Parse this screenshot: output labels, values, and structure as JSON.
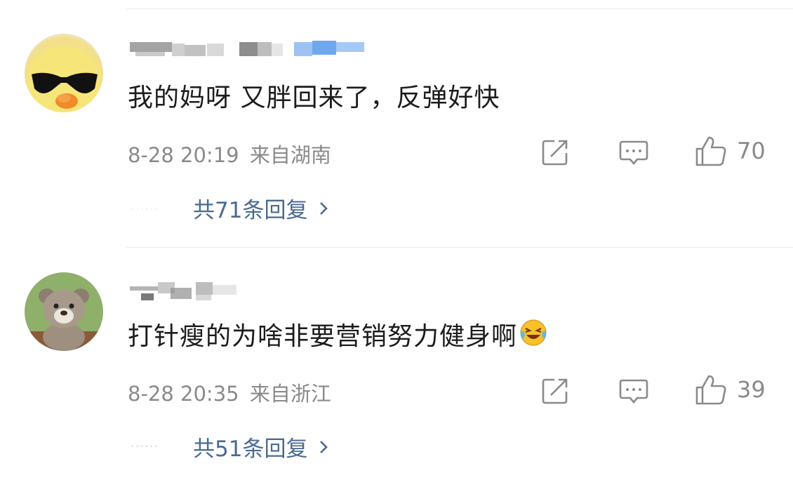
{
  "comments": [
    {
      "username": "",
      "text": "我的妈呀 又胖回来了，反弹好快",
      "time": "8-28 20:19",
      "location": "来自湖南",
      "likes": "70",
      "replies_label": "共71条回复",
      "avatar_icon": "yellow-duck-sunglasses",
      "text_emoji": ""
    },
    {
      "username": "",
      "text": "打针瘦的为啥非要营销努力健身啊",
      "time": "8-28 20:35",
      "location": "来自浙江",
      "likes": "39",
      "replies_label": "共51条回复",
      "avatar_icon": "bear-plush",
      "text_emoji": "laughing-crying-emoji"
    }
  ],
  "icons": {
    "share": "share-icon",
    "comment": "comment-icon",
    "like": "thumbs-up-icon",
    "chevron": "chevron-right-icon"
  },
  "colors": {
    "text": "#1c1c1c",
    "meta": "#8a8a8a",
    "link": "#4a6a90",
    "divider": "#ececec"
  },
  "dots": "······"
}
